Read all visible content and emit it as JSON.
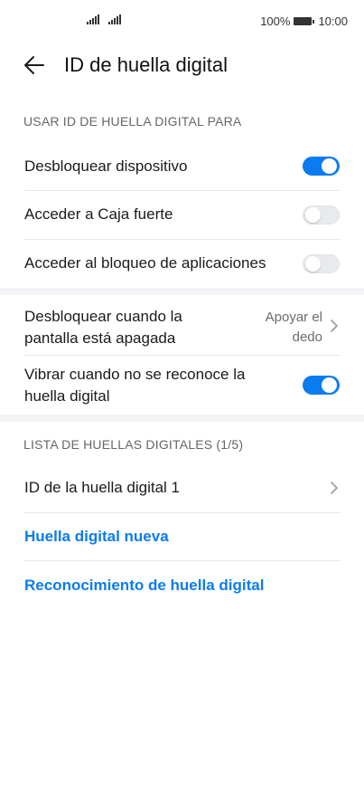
{
  "status_bar": {
    "battery_percent": "100%",
    "time": "10:00"
  },
  "header": {
    "title": "ID de huella digital"
  },
  "usage_section": {
    "title": "USAR ID DE HUELLA DIGITAL PARA",
    "items": [
      {
        "label": "Desbloquear dispositivo",
        "enabled": true
      },
      {
        "label": "Acceder a Caja fuerte",
        "enabled": false
      },
      {
        "label": "Acceder al bloqueo de aplicaciones",
        "enabled": false
      }
    ]
  },
  "screen_off": {
    "label_line1": "Desbloquear cuando la",
    "label_line2": "pantalla está apagada",
    "value_line1": "Apoyar el",
    "value_line2": "dedo"
  },
  "vibrate": {
    "label_line1": "Vibrar cuando no se reconoce la",
    "label_line2": "huella digital",
    "enabled": true
  },
  "list_section": {
    "title": "LISTA DE HUELLAS DIGITALES (1/5)",
    "items": [
      {
        "label": "ID de la huella digital 1"
      }
    ]
  },
  "actions": {
    "new_fingerprint": "Huella digital nueva",
    "recognition": "Reconocimiento de huella digital"
  },
  "colors": {
    "accent": "#0a7cf0",
    "toggle_off": "#e9eaec",
    "section_band": "#f1f3f5"
  }
}
